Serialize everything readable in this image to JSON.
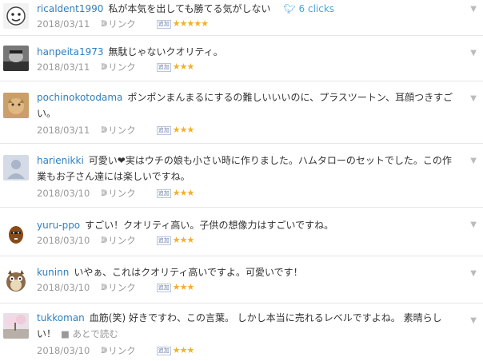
{
  "items": [
    {
      "user": "ricaldent1990",
      "comment": "私が本気を出しても勝てる気がしない",
      "date": "2018/03/11",
      "link": "リンク",
      "stars": "★★★★★",
      "tweet": "6 clicks"
    },
    {
      "user": "hanpeita1973",
      "comment": "無駄じゃないクオリティ。",
      "date": "2018/03/11",
      "link": "リンク",
      "stars": "★★★"
    },
    {
      "user": "pochinokotodama",
      "comment": "ポンポンまんまるにするの難しいいいのに、プラスツートン、耳顔つきすごい。",
      "date": "2018/03/11",
      "link": "リンク",
      "stars": "★★★"
    },
    {
      "user": "harienikki",
      "comment": "可愛い❤実はウチの娘も小さい時に作りました。ハムタローのセットでした。この作業もお子さん達には楽しいですね。",
      "date": "2018/03/10",
      "link": "リンク",
      "stars": "★★★"
    },
    {
      "user": "yuru-ppo",
      "comment": "すごい！クオリティ高い。子供の想像力はすごいですね。",
      "date": "2018/03/10",
      "link": "リンク",
      "stars": "★★★"
    },
    {
      "user": "kuninn",
      "comment": "いやぁ、これはクオリティ高いですよ。可愛いです！",
      "date": "2018/03/10",
      "link": "リンク",
      "stars": "★★★"
    },
    {
      "user": "tukkoman",
      "comment": "血筋(笑) 好きですわ、この言葉。 しかし本当に売れるレベルですよね。 素晴らしい！",
      "later": "あとで読む",
      "date": "2018/03/10",
      "link": "リンク",
      "stars": "★★★"
    }
  ],
  "star_badge": "追加"
}
